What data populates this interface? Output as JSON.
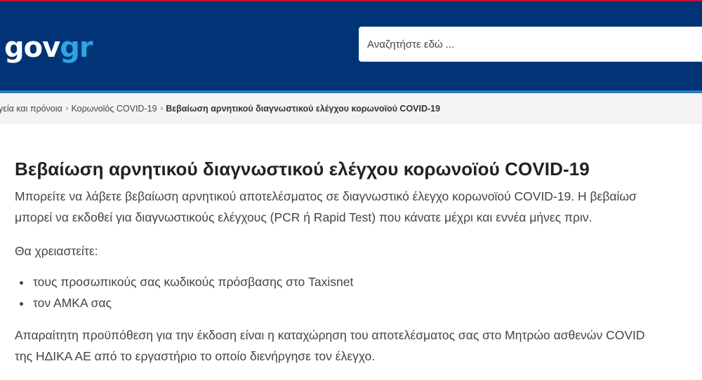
{
  "header": {
    "logo_part_a": "gov",
    "logo_part_b": "gr",
    "search_placeholder": "Αναζητήστε εδώ ..."
  },
  "breadcrumb": {
    "items": [
      "γεία και πρόνοια",
      "Κορωνοϊός COVID-19"
    ],
    "current": "Βεβαίωση αρνητικού διαγνωστικού ελέγχου κορωνοϊού COVID-19",
    "separator": "›"
  },
  "main": {
    "title": "Βεβαίωση αρνητικού διαγνωστικού ελέγχου κορωνοϊού COVID-19",
    "intro_line1": "Μπορείτε να λάβετε βεβαίωση αρνητικού αποτελέσματος σε διαγνωστικό έλεγχο κορωνοϊού COVID-19. Η βεβαίωσ",
    "intro_line2": "μπορεί να εκδοθεί για διαγνωστικούς ελέγχους (PCR ή Rapid Test) που κάνατε μέχρι και εννέα μήνες πριν.",
    "need_label": "Θα χρειαστείτε:",
    "requirements": [
      "τους προσωπικούς σας κωδικούς πρόσβασης στο Taxisnet",
      "τον ΑΜΚΑ σας"
    ],
    "precondition_line1": "Απαραίτητη προϋπόθεση για την έκδοση είναι η καταχώρηση του αποτελέσματος σας στο Μητρώο ασθενών COVID",
    "precondition_line2": "της ΗΔΙΚΑ ΑΕ από το εργαστήριο το οποίο διενήργησε τον έλεγχο."
  },
  "colors": {
    "header_bg": "#003476",
    "header_strip": "#2e7dbf",
    "logo_accent": "#2ea4e2",
    "top_line": "#c8102e"
  }
}
